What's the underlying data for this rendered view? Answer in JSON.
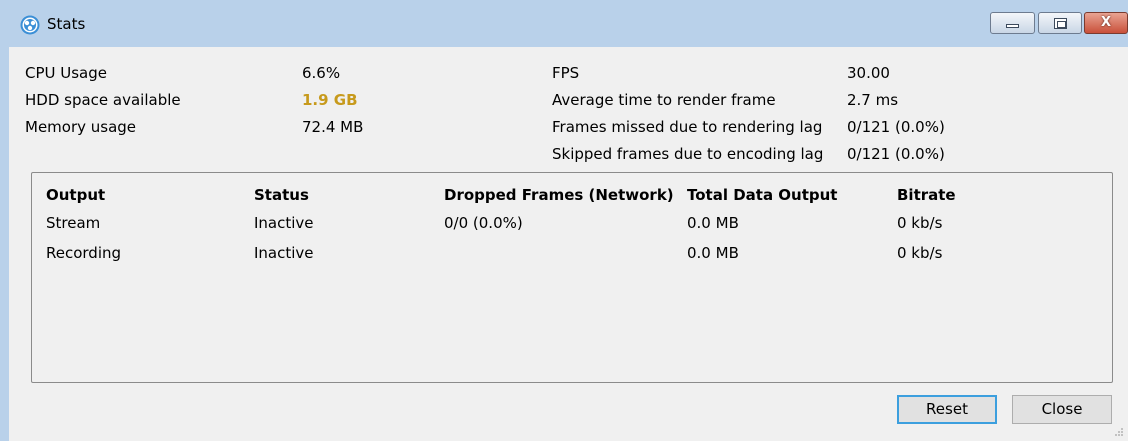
{
  "window": {
    "title": "Stats",
    "close_glyph": "X",
    "icon": "obs-app-icon"
  },
  "colors": {
    "warning": "#c79a1c",
    "focus": "#3c9fde"
  },
  "stats_left": [
    {
      "label": "CPU Usage",
      "value": "6.6%"
    },
    {
      "label": "HDD space available",
      "value": "1.9 GB"
    },
    {
      "label": "Memory usage",
      "value": "72.4 MB"
    }
  ],
  "stats_right": [
    {
      "label": "FPS",
      "value": "30.00"
    },
    {
      "label": "Average time to render frame",
      "value": "2.7 ms"
    },
    {
      "label": "Frames missed due to rendering lag",
      "value": "0/121 (0.0%)"
    },
    {
      "label": "Skipped frames due to encoding lag",
      "value": "0/121 (0.0%)"
    }
  ],
  "outputs": {
    "headers": [
      "Output",
      "Status",
      "Dropped Frames (Network)",
      "Total Data Output",
      "Bitrate"
    ],
    "rows": [
      {
        "output": "Stream",
        "status": "Inactive",
        "dropped": "0/0 (0.0%)",
        "total": "0.0 MB",
        "bitrate": "0 kb/s"
      },
      {
        "output": "Recording",
        "status": "Inactive",
        "dropped": "",
        "total": "0.0 MB",
        "bitrate": "0 kb/s"
      }
    ]
  },
  "buttons": {
    "reset": "Reset",
    "close": "Close"
  }
}
